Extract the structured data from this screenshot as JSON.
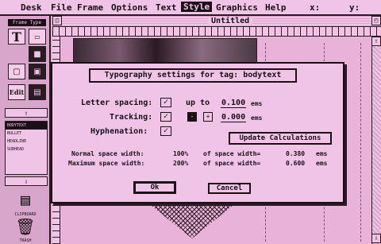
{
  "menubar": {
    "items": [
      "Desk",
      "File",
      "Frame",
      "Options",
      "Text",
      "Style",
      "Graphics",
      "Help"
    ],
    "active": "Style",
    "x_label": "x:",
    "y_label": "y:"
  },
  "toolbox": {
    "mode_label": "Frame Type",
    "tools": [
      "T",
      "Edit"
    ],
    "tags": [
      "BODYTEXT",
      "BULLET",
      "HEADLINE",
      "SUBHEAD"
    ],
    "selected_tag": "BODYTEXT",
    "desk_icons": [
      {
        "icon": "clipboard-icon",
        "glyph": "▤",
        "label": "CLIPBOARD"
      },
      {
        "icon": "trash-icon",
        "glyph": "🗑",
        "label": "TRASH"
      }
    ]
  },
  "document": {
    "title": "Untitled"
  },
  "dialog": {
    "title": "Typography settings for tag:",
    "tag_name": "bodytext",
    "letter_spacing": {
      "label": "Letter spacing:",
      "checked": true,
      "prefix": "up to",
      "value": "0.100",
      "unit": "ems"
    },
    "tracking": {
      "label": "Tracking:",
      "checked": true,
      "minus": "-",
      "plus": "+",
      "value": "0.000",
      "unit": "ems"
    },
    "hyphenation": {
      "label": "Hyphenation:",
      "checked": true
    },
    "update_button": "Update Calculations",
    "normal_space": {
      "label": "Normal space width:",
      "percent": "100%",
      "of_text": "of space width=",
      "value": "0.380",
      "unit": "ems"
    },
    "maximum_space": {
      "label": "Maximum space width:",
      "percent": "200%",
      "of_text": "of space width=",
      "value": "0.600",
      "unit": "ems"
    },
    "ok_button": "Ok",
    "cancel_button": "Cancel"
  },
  "colors": {
    "background": "#e9b3d9",
    "ink": "#1a1016",
    "panel": "#f0c4e6"
  }
}
